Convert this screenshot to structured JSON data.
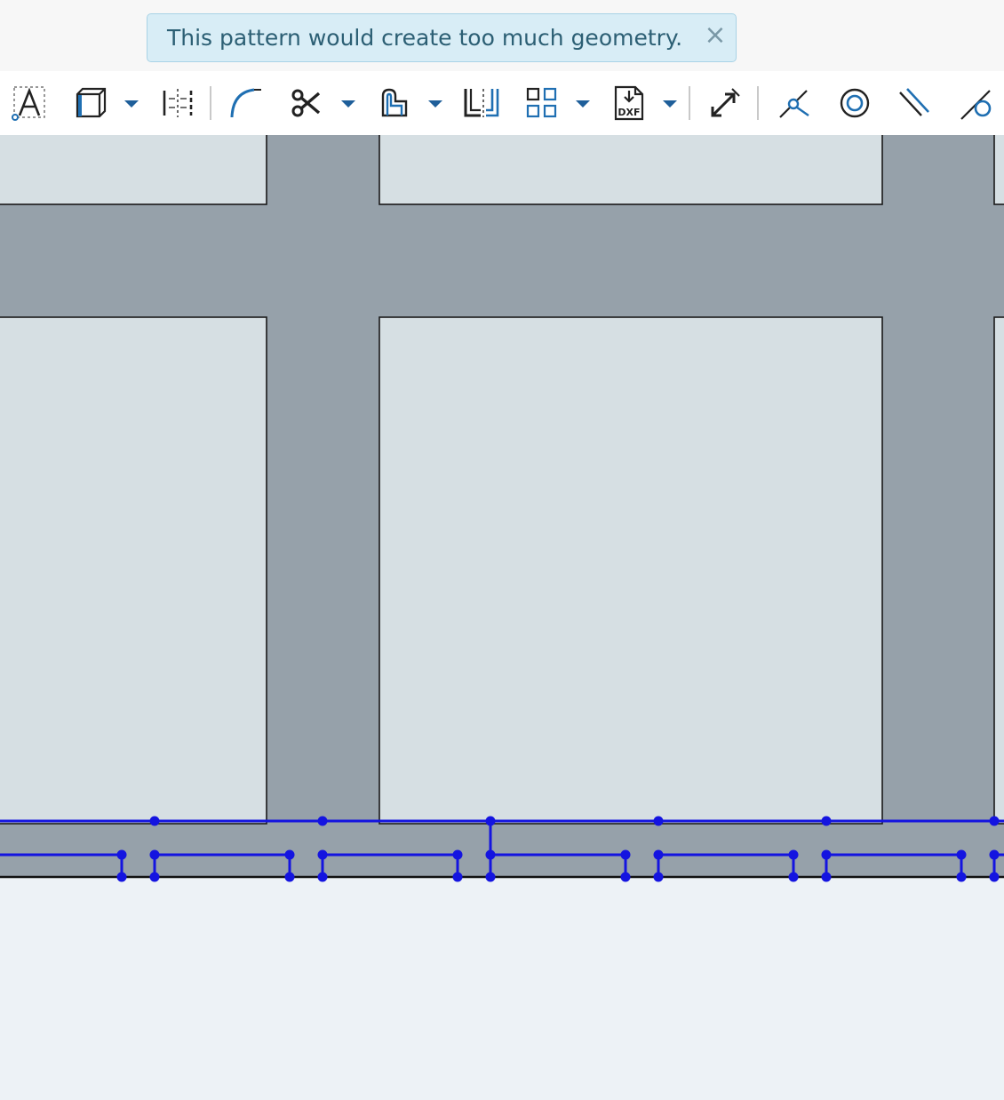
{
  "notification": {
    "message": "This pattern would create too much geometry.",
    "close_glyph": "×",
    "type": "info"
  },
  "toolbar": {
    "tools": [
      {
        "icon": "text-icon",
        "has_dropdown": false
      },
      {
        "icon": "use-project-icon",
        "has_dropdown": true
      },
      {
        "icon": "mirror-icon",
        "has_dropdown": false
      },
      {
        "icon": "fillet-icon",
        "has_dropdown": false
      },
      {
        "icon": "trim-icon",
        "has_dropdown": true
      },
      {
        "icon": "offset-icon",
        "has_dropdown": true
      },
      {
        "icon": "split-icon",
        "has_dropdown": false
      },
      {
        "icon": "pattern-icon",
        "has_dropdown": true
      },
      {
        "icon": "dxf-import-icon",
        "has_dropdown": true
      },
      {
        "icon": "transform-icon",
        "has_dropdown": false
      },
      {
        "icon": "coincident-icon",
        "has_dropdown": false
      },
      {
        "icon": "concentric-icon",
        "has_dropdown": false
      },
      {
        "icon": "parallel-icon",
        "has_dropdown": false
      },
      {
        "icon": "tangent-icon",
        "has_dropdown": false
      }
    ]
  },
  "colors": {
    "sketch_fill": "#96a1aa",
    "region_fill": "#d6dfe3",
    "background": "#edf2f6",
    "selection_blue": "#1414e0",
    "accent_blue": "#1f6fb2",
    "toast_bg": "#d8edf6",
    "toast_text": "#2c5f74"
  }
}
